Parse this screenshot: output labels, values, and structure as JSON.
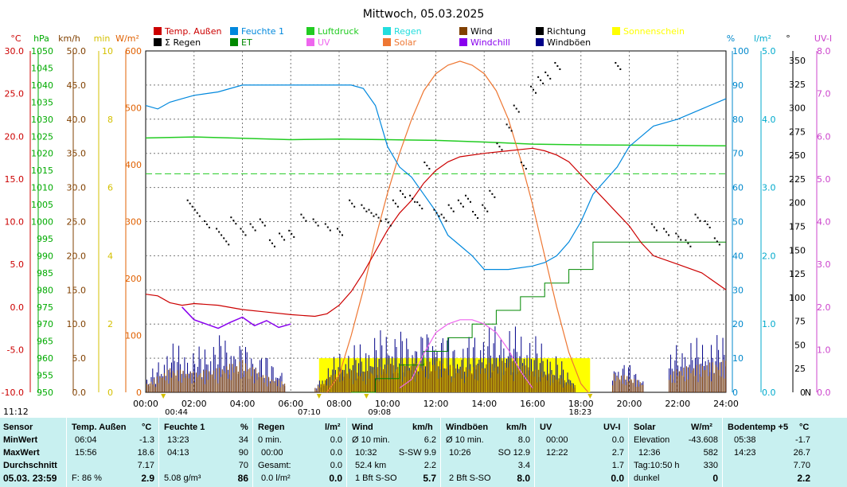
{
  "chart_data": {
    "type": "line",
    "title": "Mittwoch, 05.03.2025",
    "x_ticks": [
      "00:00",
      "02:00",
      "04:00",
      "06:00",
      "08:00",
      "10:00",
      "12:00",
      "14:00",
      "16:00",
      "18:00",
      "20:00",
      "22:00",
      "24:00"
    ],
    "x_markers": [
      "00:44",
      "07:10",
      "09:08",
      "18:23"
    ],
    "corner_time": "11:12",
    "left_axes": [
      {
        "unit": "°C",
        "color": "#cc0000",
        "ticks": [
          "30.0",
          "25.0",
          "20.0",
          "15.0",
          "10.0",
          "5.0",
          "0.0",
          "-5.0",
          "-10.0"
        ]
      },
      {
        "unit": "hPa",
        "color": "#00aa00",
        "ticks": [
          "1050",
          "1045",
          "1040",
          "1035",
          "1030",
          "1025",
          "1020",
          "1015",
          "1010",
          "1005",
          "1000",
          "995",
          "990",
          "985",
          "980",
          "975",
          "970",
          "965",
          "960",
          "955",
          "950"
        ]
      },
      {
        "unit": "km/h",
        "color": "#804000",
        "ticks": [
          "50.0",
          "45.0",
          "40.0",
          "35.0",
          "30.0",
          "25.0",
          "20.0",
          "15.0",
          "10.0",
          "5.0",
          "0.0"
        ]
      },
      {
        "unit": "min",
        "color": "#d4c000",
        "ticks": [
          "10",
          "8",
          "6",
          "4",
          "2",
          "0"
        ]
      },
      {
        "unit": "W/m²",
        "color": "#e06000",
        "ticks": [
          "600",
          "500",
          "400",
          "300",
          "200",
          "100",
          "0"
        ]
      }
    ],
    "right_axes": [
      {
        "unit": "%",
        "color": "#0088cc",
        "ticks": [
          "100",
          "90",
          "80",
          "70",
          "60",
          "50",
          "40",
          "30",
          "20",
          "10",
          "0"
        ]
      },
      {
        "unit": "l/m²",
        "color": "#00aacc",
        "ticks": [
          "5.0",
          "4.0",
          "3.0",
          "2.0",
          "1.0",
          "0.0"
        ]
      },
      {
        "unit": "°",
        "color": "#000000",
        "ticks": [
          "350",
          "325",
          "300",
          "275",
          "250",
          "225",
          "200",
          "175",
          "150",
          "125",
          "100",
          "75",
          "50",
          "25",
          "0"
        ],
        "bottom_label": "N"
      },
      {
        "unit": "UV-I",
        "color": "#cc44cc",
        "ticks": [
          "8.0",
          "7.0",
          "6.0",
          "5.0",
          "4.0",
          "3.0",
          "2.0",
          "1.0",
          "0.0"
        ]
      }
    ],
    "legend": [
      {
        "name": "Temp. Außen",
        "color": "#cc0000"
      },
      {
        "name": "Feuchte 1",
        "color": "#0088dd"
      },
      {
        "name": "Luftdruck",
        "color": "#22cc22"
      },
      {
        "name": "Regen",
        "color": "#22dddd"
      },
      {
        "name": "Wind",
        "color": "#804000"
      },
      {
        "name": "Richtung",
        "color": "#000000"
      },
      {
        "name": "Sonnenschein",
        "color": "#ffff00"
      },
      {
        "name": "Σ Regen",
        "color": "#000000"
      },
      {
        "name": "ET",
        "color": "#008800"
      },
      {
        "name": "UV",
        "color": "#ee66ee"
      },
      {
        "name": "Solar",
        "color": "#ee7733"
      },
      {
        "name": "Windchill",
        "color": "#8800ee"
      },
      {
        "name": "Windböen",
        "color": "#000088"
      }
    ],
    "series": [
      {
        "name": "Temp. Außen",
        "axis": "°C",
        "x": [
          0,
          0.5,
          1,
          1.5,
          2,
          3,
          4,
          5,
          6,
          7,
          7.5,
          8,
          8.5,
          9,
          9.5,
          10,
          10.5,
          11,
          11.5,
          12,
          12.5,
          13,
          14,
          15,
          16,
          16.5,
          17,
          17.5,
          18,
          18.5,
          19,
          19.5,
          20,
          20.5,
          21,
          22,
          23,
          24
        ],
        "y": [
          1.5,
          1.3,
          0.5,
          0.2,
          0.4,
          0.2,
          -0.3,
          -0.6,
          -0.9,
          -1.1,
          -0.8,
          0.2,
          1.8,
          4.0,
          6.5,
          9.0,
          11.0,
          12.5,
          14.5,
          16.0,
          17.0,
          17.6,
          18.0,
          18.3,
          18.6,
          18.3,
          17.8,
          17.0,
          15.5,
          14.0,
          12.5,
          11.0,
          9.5,
          7.5,
          6.0,
          5.0,
          4.0,
          2.0
        ]
      },
      {
        "name": "Feuchte 1",
        "axis": "%",
        "x": [
          0,
          0.5,
          1,
          1.5,
          2,
          3,
          4,
          5,
          6,
          7,
          8,
          8.5,
          9,
          9.5,
          10,
          10.5,
          11,
          11.5,
          12,
          12.5,
          13,
          13.5,
          14,
          15,
          16,
          16.5,
          17,
          17.5,
          18,
          18.5,
          19,
          19.5,
          20,
          21,
          22,
          23,
          24
        ],
        "y": [
          84,
          83,
          85,
          86,
          87,
          88,
          90,
          90,
          90,
          90,
          90,
          90,
          89,
          84,
          72,
          66,
          63,
          58,
          53,
          46,
          43,
          40,
          36,
          36,
          37,
          38,
          40,
          44,
          50,
          58,
          62,
          66,
          72,
          78,
          80,
          83,
          86
        ]
      },
      {
        "name": "Luftdruck",
        "axis": "hPa",
        "x": [
          0,
          2,
          4,
          6,
          8,
          10,
          12,
          14,
          16,
          18,
          20,
          22,
          24
        ],
        "y": [
          1024.5,
          1024.8,
          1024.4,
          1024.0,
          1024.2,
          1024.0,
          1023.8,
          1023.3,
          1022.7,
          1022.5,
          1022.4,
          1022.3,
          1022.2
        ]
      },
      {
        "name": "Regen",
        "axis": "l/m²",
        "x": [
          0,
          24
        ],
        "y": [
          3.2,
          3.2
        ]
      },
      {
        "name": "Solar",
        "axis": "W/m²",
        "x": [
          7.5,
          8,
          8.5,
          9,
          9.5,
          10,
          10.5,
          11,
          11.5,
          12,
          12.5,
          13,
          13.5,
          14,
          14.5,
          15,
          15.5,
          16,
          16.5,
          17,
          17.5,
          18,
          18.3
        ],
        "y": [
          0,
          30,
          100,
          180,
          270,
          350,
          420,
          480,
          530,
          560,
          575,
          582,
          575,
          560,
          530,
          480,
          410,
          330,
          240,
          150,
          70,
          15,
          0
        ]
      },
      {
        "name": "UV",
        "axis": "UV-I",
        "x": [
          10.5,
          11,
          11.5,
          12,
          12.5,
          13,
          13.5,
          14,
          14.5,
          15,
          15.5,
          16
        ],
        "y": [
          0.1,
          0.3,
          0.9,
          1.4,
          1.6,
          1.7,
          1.7,
          1.6,
          1.4,
          1.0,
          0.5,
          0.1
        ]
      },
      {
        "name": "ET",
        "axis": "mm",
        "x": [
          8.5,
          9.5,
          10.5,
          11.5,
          12.5,
          13.5,
          14.5,
          15.5,
          16.5,
          17.5,
          18.5,
          24
        ],
        "y": [
          0,
          0.2,
          0.4,
          0.6,
          0.8,
          1.0,
          1.2,
          1.4,
          1.6,
          1.8,
          2.2,
          2.2
        ]
      },
      {
        "name": "Windchill",
        "axis": "°C",
        "x": [
          1.5,
          2,
          2.5,
          3,
          3.5,
          4,
          4.5,
          5,
          5.5,
          6
        ],
        "y": [
          0.0,
          -1.5,
          -2.0,
          -2.5,
          -1.8,
          -1.2,
          -2.2,
          -1.6,
          -2.4,
          -2.0
        ]
      },
      {
        "name": "Richtung",
        "axis": "°",
        "x": [
          1.8,
          2.1,
          2.5,
          3.0,
          3.3,
          3.6,
          4.0,
          4.4,
          4.8,
          5.2,
          5.6,
          6.0,
          6.5,
          7.0,
          7.5,
          8.0,
          8.5,
          9.0,
          9.3,
          9.6,
          10.0,
          10.3,
          10.6,
          11.0,
          11.3,
          11.6,
          12.0,
          12.3,
          12.6,
          13.0,
          13.3,
          13.6,
          14.0,
          14.3,
          14.6,
          15.0,
          15.3,
          15.6,
          16.0,
          16.3,
          16.6,
          17.0,
          19.5,
          21.0,
          21.5,
          22.0,
          22.4,
          22.8,
          23.2,
          23.6
        ],
        "y": [
          200,
          190,
          178,
          170,
          160,
          182,
          170,
          175,
          180,
          158,
          165,
          168,
          185,
          180,
          175,
          170,
          200,
          195,
          190,
          185,
          180,
          200,
          210,
          205,
          198,
          240,
          190,
          185,
          195,
          200,
          205,
          188,
          195,
          210,
          260,
          280,
          300,
          240,
          320,
          330,
          335,
          345,
          345,
          175,
          170,
          165,
          158,
          185,
          178,
          160
        ]
      },
      {
        "name": "Wind",
        "axis": "km/h",
        "x": [
          0,
          1,
          2,
          3,
          4,
          5,
          6,
          7,
          8,
          9,
          10,
          11,
          12,
          13,
          14,
          15,
          16,
          17,
          18,
          19,
          20,
          21,
          22,
          23,
          24
        ],
        "y": [
          1,
          3,
          2.5,
          3,
          4,
          2,
          1,
          0.5,
          3,
          2.5,
          3.5,
          3.5,
          4,
          3,
          3.5,
          4,
          3,
          2,
          0.5,
          2.5,
          2,
          0.5,
          3,
          3.5,
          4
        ]
      },
      {
        "name": "Windböen",
        "axis": "km/h",
        "x": [
          0,
          1,
          2,
          3,
          4,
          5,
          6,
          7,
          8,
          9,
          10,
          11,
          12,
          13,
          14,
          15,
          16,
          17,
          18,
          19,
          20,
          21,
          22,
          23,
          24
        ],
        "y": [
          1.5,
          6,
          5,
          7,
          6,
          4.5,
          2,
          1,
          5,
          6,
          8,
          7,
          8,
          6,
          8,
          8,
          7,
          4.5,
          1,
          4,
          3.5,
          1,
          6,
          6.5,
          7
        ]
      },
      {
        "name": "Sonnenschein",
        "axis": "min",
        "x": [
          7.17,
          18.38
        ],
        "y": [
          1,
          1
        ]
      }
    ]
  },
  "panel": {
    "sensor": {
      "header": "Sensor",
      "rows": [
        "MinWert",
        "MaxWert",
        "Durchschnitt"
      ],
      "date": "05.03.  23:59"
    },
    "temp": {
      "header": "Temp. Außen",
      "unit": "°C",
      "min_time": "06:04",
      "min": "-1.3",
      "max_time": "15:56",
      "max": "18.6",
      "avg": "7.17",
      "extra_label": "F: 86 %",
      "current": "2.9"
    },
    "feuchte": {
      "header": "Feuchte 1",
      "unit": "%",
      "min_time": "13:23",
      "min": "34",
      "max_time": "04:13",
      "max": "90",
      "avg": "70",
      "extra_label": "5.08 g/m³",
      "current": "86"
    },
    "regen": {
      "header": "Regen",
      "unit": "l/m²",
      "r1_label": "0 min.",
      "r1_val": "0.0",
      "r2_label": "00:00",
      "r2_val": "0.0",
      "r3_label": "Gesamt:",
      "r3_val": "0.0",
      "r4_label": "0.0 l/m²",
      "current": "0.0"
    },
    "wind": {
      "header": "Wind",
      "unit": "km/h",
      "r1_label": "Ø 10 min.",
      "r1_val": "6.2",
      "r2_time": "10:32",
      "r2_dir": "S-SW 9.9",
      "r3_label": "52.4 km",
      "r3_val": "2.2",
      "r4_label": "1 Bft S-SO",
      "current": "5.7"
    },
    "boeen": {
      "header": "Windböen",
      "unit": "km/h",
      "r1_label": "Ø 10 min.",
      "r1_val": "8.0",
      "r2_time": "10:26",
      "r2_dir": "SO 12.9",
      "r3_val": "3.4",
      "r4_label": "2 Bft S-SO",
      "current": "8.0"
    },
    "uv": {
      "header": "UV",
      "unit": "UV-I",
      "r1_time": "00:00",
      "r1_val": "0.0",
      "r2_time": "12:22",
      "r2_val": "2.7",
      "r3_val": "1.7",
      "current": "0.0"
    },
    "solar": {
      "header": "Solar",
      "unit": "W/m²",
      "r1_label": "Elevation",
      "r1_val": "-43.608",
      "r2_time": "12:36",
      "r2_val": "582",
      "r3_label": "Tag:10:50 h",
      "r3_val": "330",
      "r4_label": "dunkel",
      "current": "0"
    },
    "boden": {
      "header": "Bodentemp +5",
      "unit": "°C",
      "min_time": "05:38",
      "min": "-1.7",
      "max_time": "14:23",
      "max": "26.7",
      "avg": "7.70",
      "current": "2.2"
    }
  }
}
